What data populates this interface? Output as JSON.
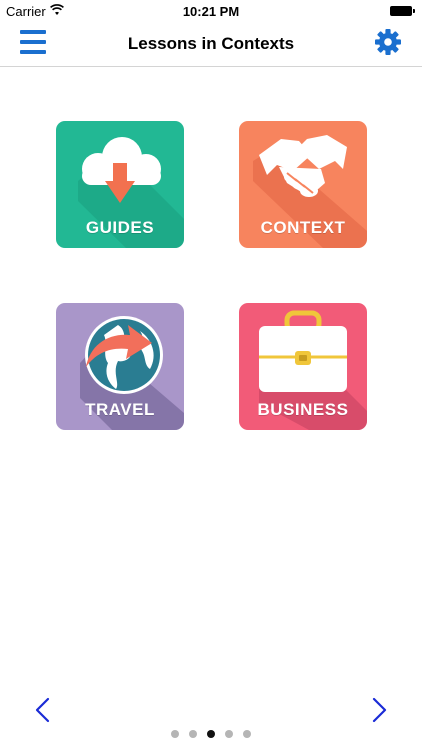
{
  "status_bar": {
    "carrier": "Carrier",
    "time": "10:21 PM"
  },
  "nav": {
    "title": "Lessons in Contexts",
    "menu_icon": "hamburger-menu-icon",
    "settings_icon": "gear-icon"
  },
  "tiles": [
    {
      "label": "GUIDES",
      "icon": "cloud-download-icon",
      "color": "#22b894"
    },
    {
      "label": "CONTEXT",
      "icon": "handshake-icon",
      "color": "#f7845e"
    },
    {
      "label": "TRAVEL",
      "icon": "globe-arrow-icon",
      "color": "#a996c9"
    },
    {
      "label": "BUSINESS",
      "icon": "briefcase-icon",
      "color": "#f25b78"
    }
  ],
  "pager": {
    "total": 5,
    "current": 3,
    "prev_icon": "chevron-left-icon",
    "next_icon": "chevron-right-icon"
  },
  "colors": {
    "accent": "#1a6fcf"
  }
}
